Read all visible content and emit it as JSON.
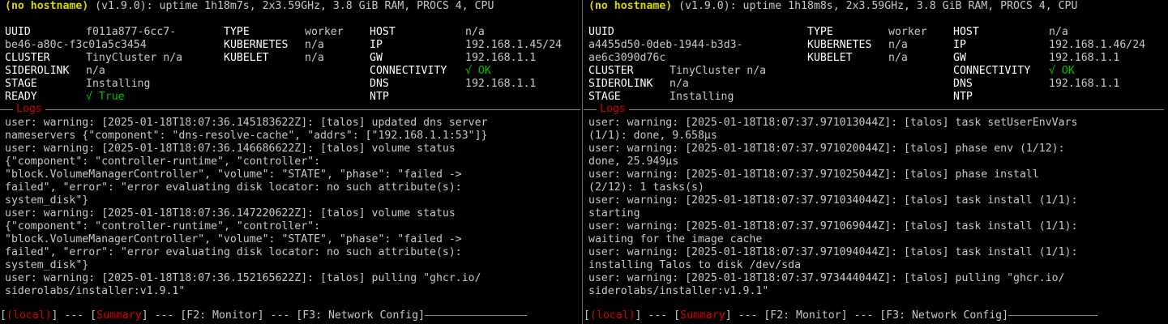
{
  "panes": [
    {
      "header": {
        "hostname": "(no hostname)",
        "info": " (v1.9.0): uptime 1h18m7s, 2x3.59GHz, 3.8 GiB RAM, PROCS 4, CPU"
      },
      "summary": {
        "uuid_key": "UUID",
        "uuid_val_1": "f011a877-6cc7-",
        "uuid_val_2": "be46-a80c-f3c01a5c3454",
        "cluster_key": "CLUSTER",
        "cluster_val": "TinyCluster n/a",
        "siderolink_key": "SIDEROLINK",
        "siderolink_val": "n/a",
        "stage_key": "STAGE",
        "stage_val": "Installing",
        "ready_key": "READY",
        "ready_val": "√ True",
        "type_key": "TYPE",
        "type_val": "worker",
        "kubernetes_key": "KUBERNETES",
        "kubernetes_val": "n/a",
        "kubelet_key": "KUBELET",
        "kubelet_val": "n/a",
        "host_key": "HOST",
        "host_val": "n/a",
        "ip_key": "IP",
        "ip_val": "192.168.1.45/24",
        "gw_key": "GW",
        "gw_val": "192.168.1.1",
        "connectivity_key": "CONNECTIVITY",
        "connectivity_val": "√ OK",
        "dns_key": "DNS",
        "dns_val": "192.168.1.1",
        "ntp_key": "NTP",
        "ntp_val": ""
      },
      "logs_title": "Logs",
      "logs": [
        "user: warning: [2025-01-18T18:07:36.145183622Z]: [talos] updated dns server",
        "nameservers {\"component\": \"dns-resolve-cache\", \"addrs\": [\"192.168.1.1:53\"]}",
        "user: warning: [2025-01-18T18:07:36.146686622Z]: [talos] volume status",
        "{\"component\": \"controller-runtime\", \"controller\":",
        "\"block.VolumeManagerController\", \"volume\": \"STATE\", \"phase\": \"failed ->",
        "failed\", \"error\": \"error evaluating disk locator: no such attribute(s):",
        "system_disk\"}",
        "user: warning: [2025-01-18T18:07:36.147220622Z]: [talos] volume status",
        "{\"component\": \"controller-runtime\", \"controller\":",
        "\"block.VolumeManagerController\", \"volume\": \"STATE\", \"phase\": \"failed ->",
        "failed\", \"error\": \"error evaluating disk locator: no such attribute(s):",
        "system_disk\"}",
        "user: warning: [2025-01-18T18:07:36.152165622Z]: [talos] pulling \"ghcr.io/",
        "siderolabs/installer:v1.9.1\""
      ],
      "footer": {
        "local": "(local)",
        "summary": "Summary",
        "f2": "F2: Monitor",
        "f3": "F3: Network Config"
      }
    },
    {
      "header": {
        "hostname": "(no hostname)",
        "info": " (v1.9.0): uptime 1h18m8s, 2x3.59GHz, 3.8 GiB RAM, PROCS 4, CPU"
      },
      "summary": {
        "uuid_key": "UUID",
        "uuid_val_1": "a4455d50-0deb-1944-b3d3-",
        "uuid_val_2": "ae6c3090d76c",
        "cluster_key": "CLUSTER",
        "cluster_val": "TinyCluster n/a",
        "siderolink_key": "SIDEROLINK",
        "siderolink_val": "n/a",
        "stage_key": "STAGE",
        "stage_val": "Installing",
        "type_key": "TYPE",
        "type_val": "worker",
        "kubernetes_key": "KUBERNETES",
        "kubernetes_val": "n/a",
        "kubelet_key": "KUBELET",
        "kubelet_val": "n/a",
        "host_key": "HOST",
        "host_val": "n/a",
        "ip_key": "IP",
        "ip_val": "192.168.1.46/24",
        "gw_key": "GW",
        "gw_val": "192.168.1.1",
        "connectivity_key": "CONNECTIVITY",
        "connectivity_val": "√ OK",
        "dns_key": "DNS",
        "dns_val": "192.168.1.1",
        "ntp_key": "NTP",
        "ntp_val": ""
      },
      "logs_title": "Logs",
      "logs": [
        "user: warning: [2025-01-18T18:07:37.971013044Z]: [talos] task setUserEnvVars",
        "(1/1): done, 9.658µs",
        "user: warning: [2025-01-18T18:07:37.971020044Z]: [talos] phase env (1/12):",
        "done, 25.949µs",
        "user: warning: [2025-01-18T18:07:37.971025044Z]: [talos] phase install",
        "(2/12): 1 tasks(s)",
        "user: warning: [2025-01-18T18:07:37.971034044Z]: [talos] task install (1/1):",
        "starting",
        "user: warning: [2025-01-18T18:07:37.971069044Z]: [talos] task install (1/1):",
        "waiting for the image cache",
        "user: warning: [2025-01-18T18:07:37.971094044Z]: [talos] task install (1/1):",
        "installing Talos to disk /dev/sda",
        "user: warning: [2025-01-18T18:07:37.973444044Z]: [talos] pulling \"ghcr.io/",
        "siderolabs/installer:v1.9.1\""
      ],
      "footer": {
        "local": "(local)",
        "summary": "Summary",
        "f2": "F2: Monitor",
        "f3": "F3: Network Config"
      }
    }
  ],
  "colors": {
    "hostname": "#d7d700",
    "ok": "#00c000",
    "accent_red": "#d70000",
    "text": "#c8c8c8",
    "background": "#000000"
  }
}
